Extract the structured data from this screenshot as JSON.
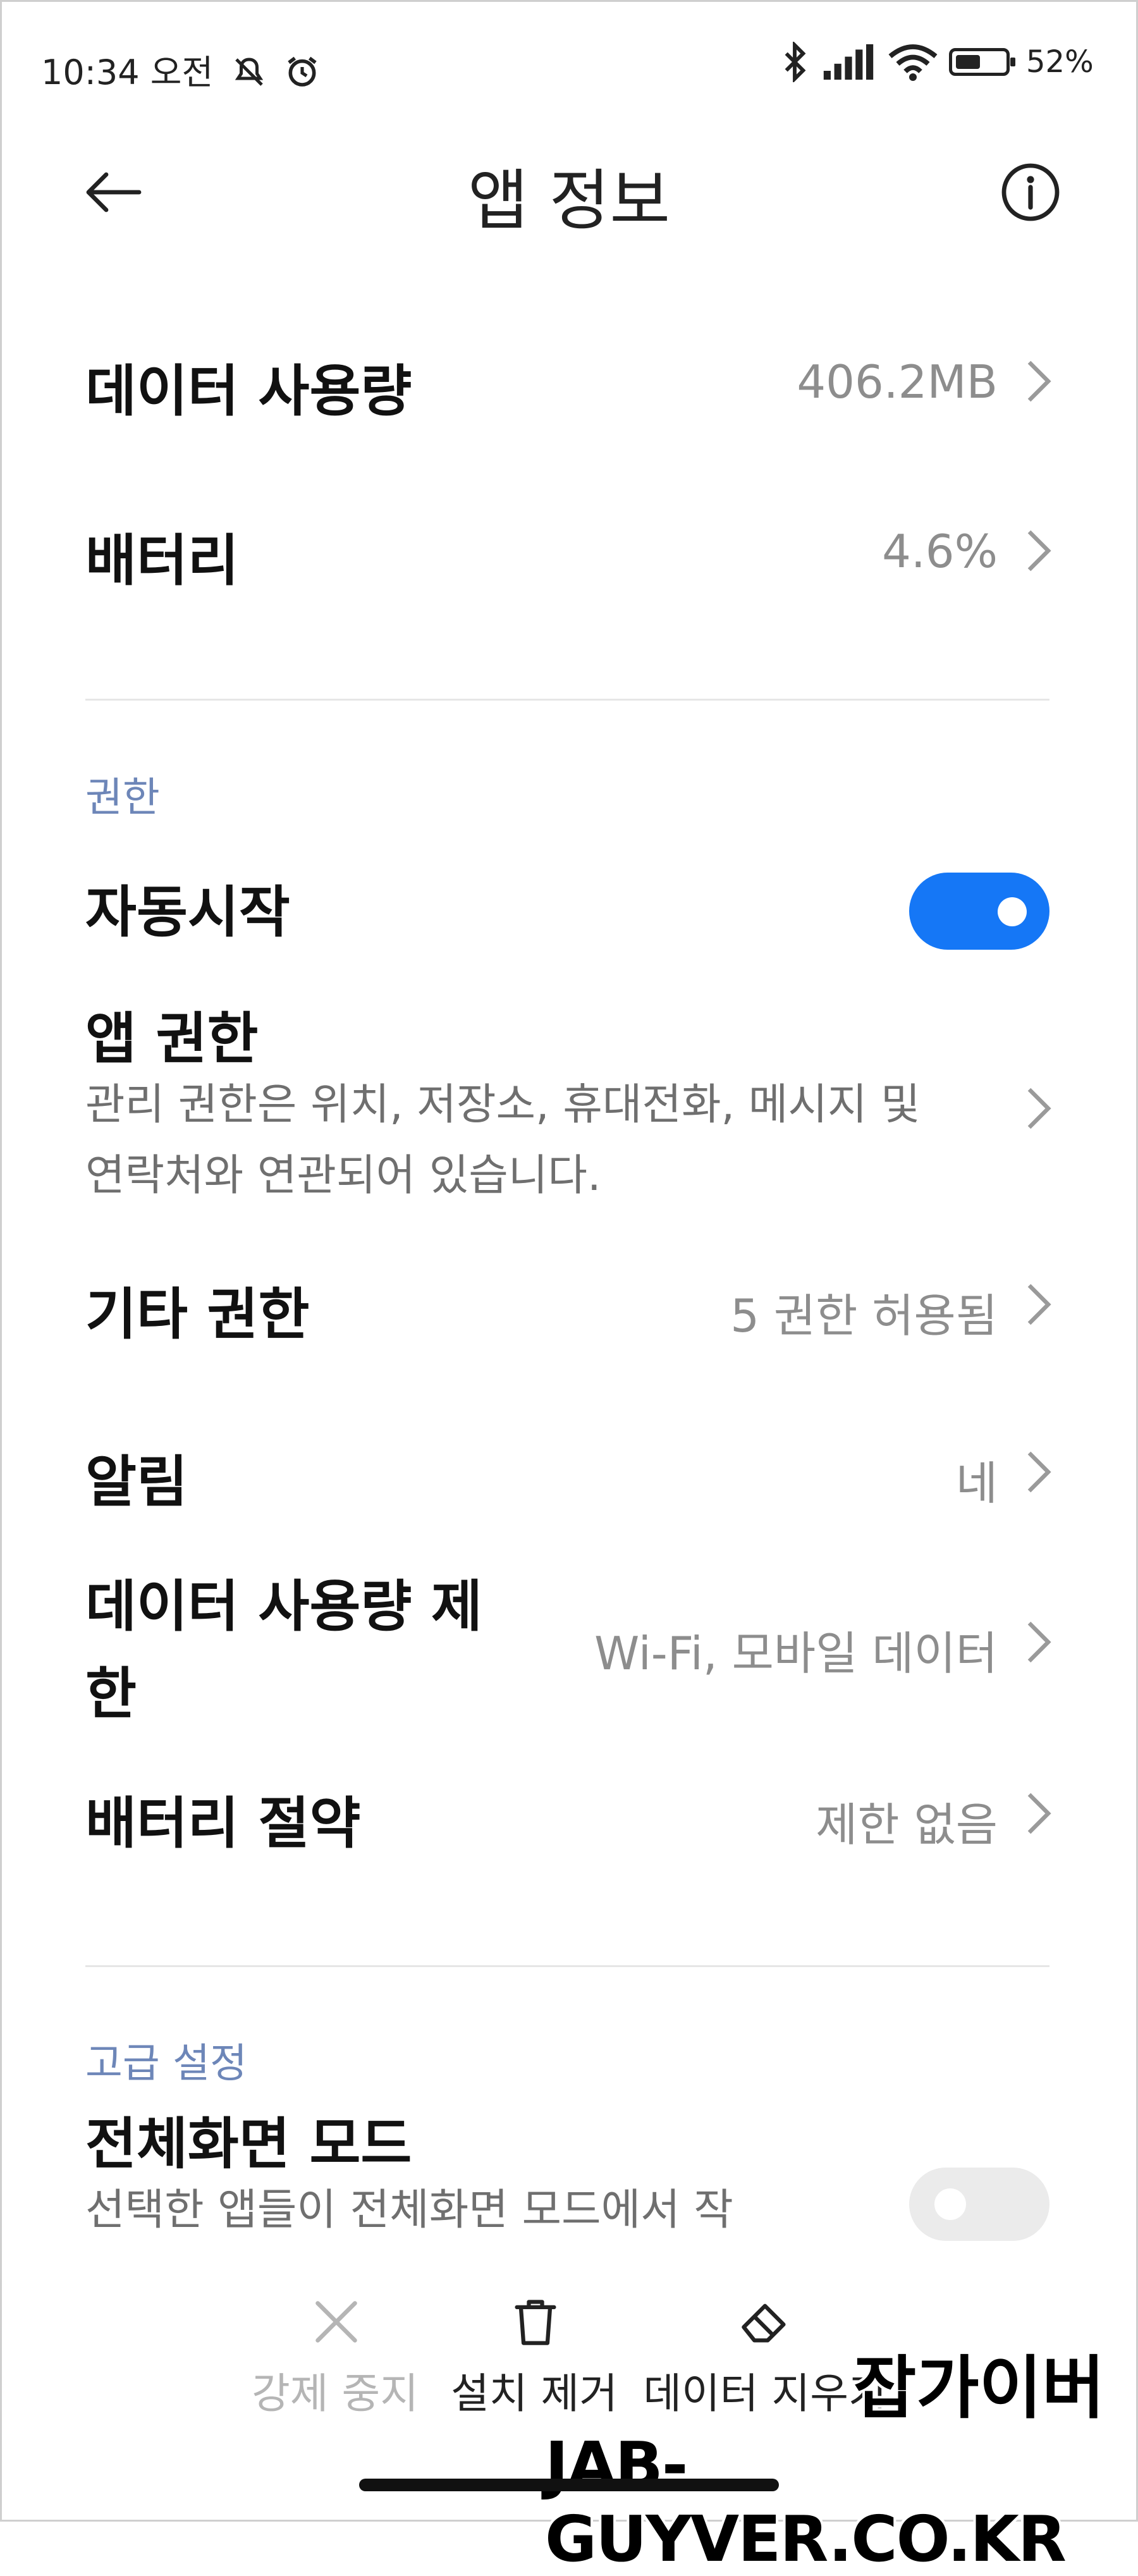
{
  "status_bar": {
    "time": "10:34 오전",
    "battery_percent": "52%",
    "battery_level": 0.52,
    "icons": [
      "mute-notification-icon",
      "alarm-icon",
      "bluetooth-icon",
      "signal-icon",
      "wifi-icon",
      "battery-icon"
    ]
  },
  "header": {
    "title": "앱 정보",
    "back_icon": "back-arrow-icon",
    "info_icon": "info-icon"
  },
  "usage": {
    "data_usage": {
      "label": "데이터 사용량",
      "value": "406.2MB"
    },
    "battery": {
      "label": "배터리",
      "value": "4.6%"
    }
  },
  "permissions": {
    "section_title": "권한",
    "autostart": {
      "label": "자동시작",
      "enabled": true
    },
    "app_permissions": {
      "label": "앱 권한",
      "description_line1": "관리 권한은 위치, 저장소, 휴대전화, 메시지 및",
      "description_line2": "연락처와 연관되어 있습니다."
    },
    "other_permissions": {
      "label": "기타 권한",
      "value": "5 권한 허용됨"
    },
    "notifications": {
      "label": "알림",
      "value": "네"
    },
    "data_limit": {
      "label_line1": "데이터 사용량 제",
      "label_line2": "한",
      "value": "Wi-Fi, 모바일 데이터"
    },
    "battery_saver": {
      "label": "배터리 절약",
      "value": "제한 없음"
    }
  },
  "advanced": {
    "section_title": "고급 설정",
    "fullscreen": {
      "label": "전체화면 모드",
      "description": "선택한 앱들이 전체화면 모드에서 작",
      "enabled": false
    }
  },
  "bottom_actions": {
    "force_stop": "강제 중지",
    "uninstall": "설치 제거",
    "clear_data": "데이터 지우기"
  },
  "watermark": {
    "korean": "잡가이버",
    "english": "JAB-GUYVER.CO.KR"
  },
  "colors": {
    "accent": "#1577f6",
    "section_title": "#6d86b8",
    "secondary_text": "#8d8d8d",
    "disabled_text": "#b5b5b5"
  }
}
